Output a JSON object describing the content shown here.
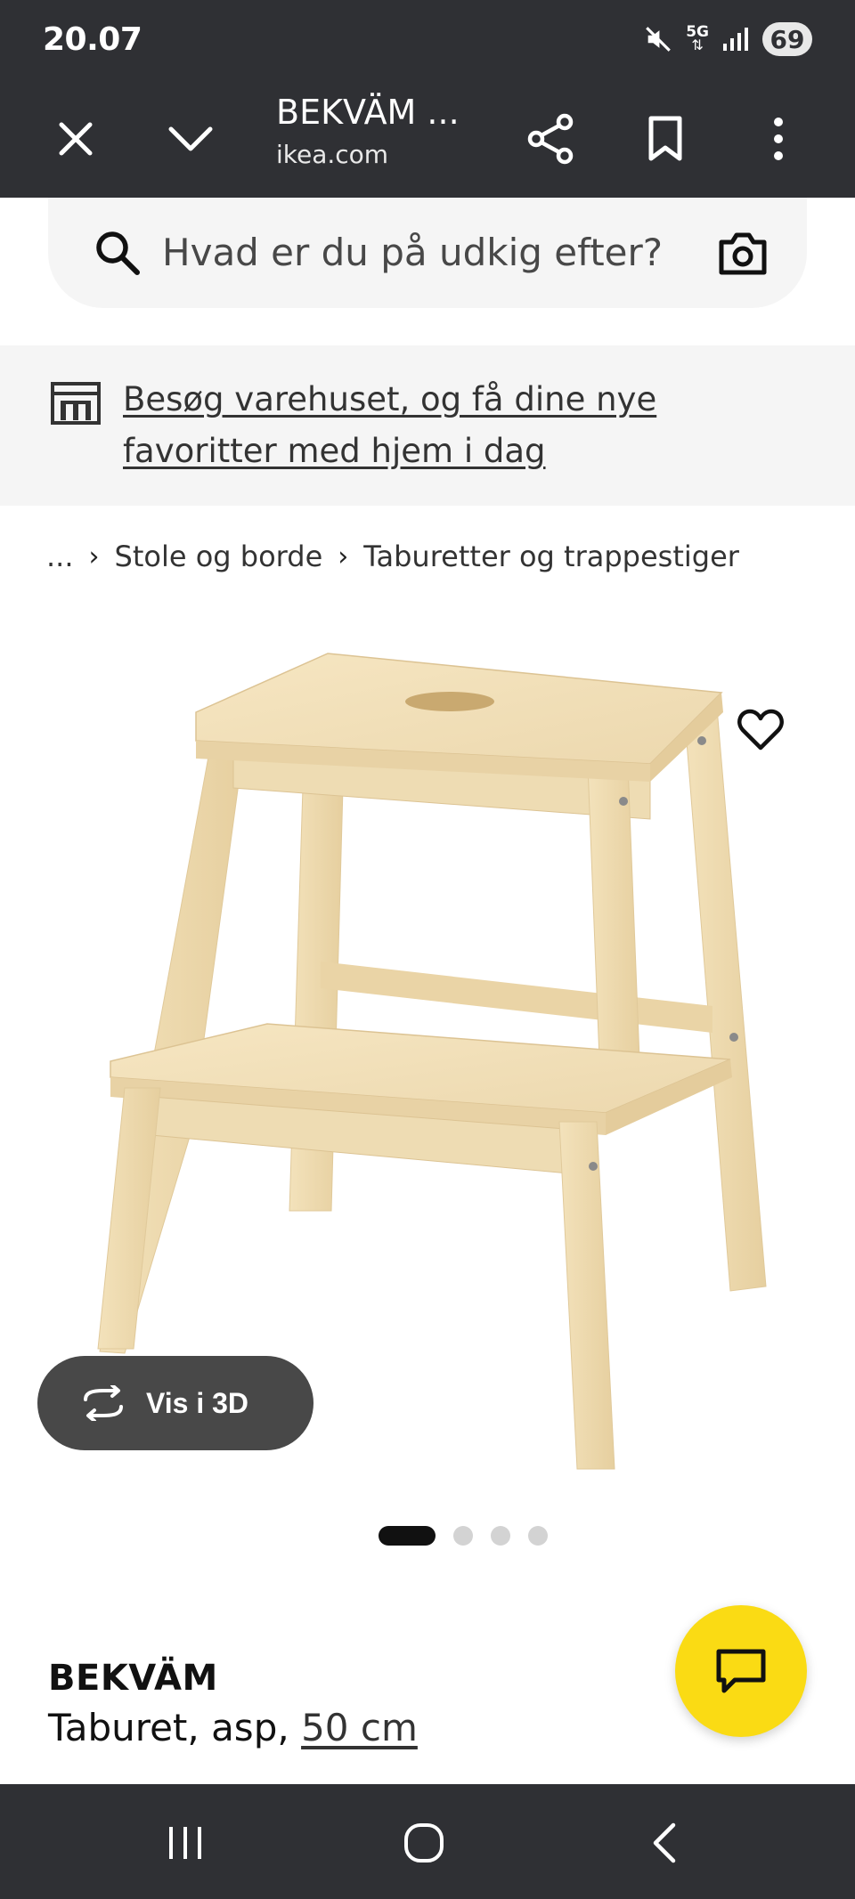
{
  "status_bar": {
    "time": "20.07",
    "network_label": "5G",
    "battery": "69"
  },
  "browser": {
    "title": "BEKVÄM ...",
    "domain": "ikea.com"
  },
  "search": {
    "placeholder": "Hvad er du på udkig efter?"
  },
  "banner": {
    "text": "Besøg varehuset, og få dine nye favoritter med hjem i dag"
  },
  "breadcrumb": {
    "items": [
      "...",
      "Stole og borde",
      "Taburetter og trappestiger"
    ]
  },
  "gallery": {
    "view_3d_label": "Vis i 3D",
    "image_count": 4,
    "active_index": 0
  },
  "product": {
    "name": "BEKVÄM",
    "description": "Taburet, asp, ",
    "size": "50 cm"
  },
  "colors": {
    "chrome": "#2f3034",
    "chat_button": "#fadb14",
    "wood_light": "#f2e2bd"
  },
  "icons": [
    "close-icon",
    "chevron-down-icon",
    "share-icon",
    "bookmark-icon",
    "more-vert-icon",
    "search-icon",
    "camera-icon",
    "store-icon",
    "heart-icon",
    "rotate-3d-icon",
    "chat-icon",
    "recent-apps-icon",
    "home-icon",
    "back-icon"
  ]
}
